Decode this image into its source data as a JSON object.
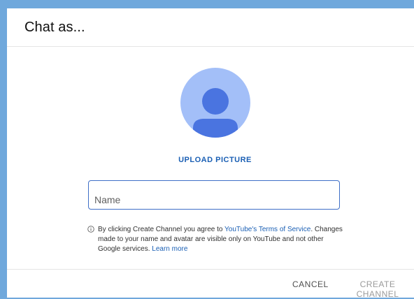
{
  "dialog": {
    "title": "Chat as...",
    "avatar_icon": "person-icon",
    "upload_label": "UPLOAD PICTURE",
    "name_field": {
      "placeholder": "Name",
      "value": ""
    },
    "info": {
      "icon": "info-icon",
      "text_before": "By clicking Create Channel you agree to ",
      "terms_link": "YouTube's Terms of Service",
      "text_after": ". Changes made to your name and avatar are visible only on YouTube and not other Google services. ",
      "learn_more_link": "Learn more"
    },
    "actions": {
      "cancel_label": "CANCEL",
      "create_label": "CREATE CHANNEL"
    }
  },
  "colors": {
    "frame_accent": "#6fa8dc",
    "link": "#1a5fb4",
    "avatar_bg": "#a3bff8",
    "avatar_figure": "#4a74e0",
    "field_border": "#3f6fc7",
    "disabled_text": "#9a9a9a"
  }
}
